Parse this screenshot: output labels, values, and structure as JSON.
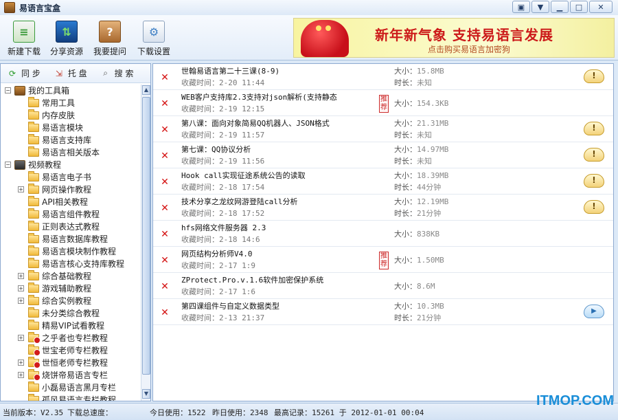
{
  "window": {
    "title": "易语言宝盒",
    "buttons": [
      "chat-icon",
      "dropdown-icon",
      "minimize-icon",
      "maximize-icon",
      "close-icon"
    ]
  },
  "toolbar": {
    "items": [
      {
        "label": "新建下载",
        "icon": "new-download-icon",
        "color": "#3a9a3a"
      },
      {
        "label": "分享资源",
        "icon": "share-icon",
        "color": "#1d5fa8"
      },
      {
        "label": "我要提问",
        "icon": "question-icon",
        "color": "#b5773a"
      },
      {
        "label": "下载设置",
        "icon": "settings-icon",
        "color": "#7a8fa8"
      }
    ]
  },
  "banner": {
    "headline": "新年新气象 支持易语言发展",
    "subline": "点击购买易语言加密狗"
  },
  "sidebar": {
    "tabs": [
      {
        "label": "同 步",
        "icon": "sync-icon"
      },
      {
        "label": "托 盘",
        "icon": "tray-icon"
      },
      {
        "label": "搜 索",
        "icon": "search-icon"
      }
    ],
    "tree": [
      {
        "label": "我的工具箱",
        "level": 0,
        "expander": "−",
        "type": "root"
      },
      {
        "label": "常用工具",
        "level": 1,
        "expander": "",
        "type": "folder"
      },
      {
        "label": "内存皮肤",
        "level": 1,
        "expander": "",
        "type": "folder"
      },
      {
        "label": "易语言模块",
        "level": 1,
        "expander": "",
        "type": "folder"
      },
      {
        "label": "易语言支持库",
        "level": 1,
        "expander": "",
        "type": "folder"
      },
      {
        "label": "易语言相关版本",
        "level": 1,
        "expander": "",
        "type": "folder"
      },
      {
        "label": "视频教程",
        "level": 0,
        "expander": "−",
        "type": "root"
      },
      {
        "label": "易语言电子书",
        "level": 1,
        "expander": "",
        "type": "folder"
      },
      {
        "label": "网页操作教程",
        "level": 1,
        "expander": "+",
        "type": "folder"
      },
      {
        "label": "API相关教程",
        "level": 1,
        "expander": "",
        "type": "folder"
      },
      {
        "label": "易语言组件教程",
        "level": 1,
        "expander": "",
        "type": "folder"
      },
      {
        "label": "正则表达式教程",
        "level": 1,
        "expander": "",
        "type": "folder"
      },
      {
        "label": "易语言数据库教程",
        "level": 1,
        "expander": "",
        "type": "folder"
      },
      {
        "label": "易语言模块制作教程",
        "level": 1,
        "expander": "",
        "type": "folder"
      },
      {
        "label": "易语言核心支持库教程",
        "level": 1,
        "expander": "",
        "type": "folder"
      },
      {
        "label": "综合基础教程",
        "level": 1,
        "expander": "+",
        "type": "folder"
      },
      {
        "label": "游戏辅助教程",
        "level": 1,
        "expander": "+",
        "type": "folder"
      },
      {
        "label": "综合实例教程",
        "level": 1,
        "expander": "+",
        "type": "folder"
      },
      {
        "label": "未分类综合教程",
        "level": 1,
        "expander": "",
        "type": "folder"
      },
      {
        "label": "精易VIP试看教程",
        "level": 1,
        "expander": "",
        "type": "folder"
      },
      {
        "label": "之乎者也专栏教程",
        "level": 1,
        "expander": "+",
        "type": "folder-red"
      },
      {
        "label": "世宝老师专栏教程",
        "level": 1,
        "expander": "",
        "type": "folder-red"
      },
      {
        "label": "世恒老师专栏教程",
        "level": 1,
        "expander": "+",
        "type": "folder-red"
      },
      {
        "label": "烧饼帝易语言专栏",
        "level": 1,
        "expander": "+",
        "type": "folder-red"
      },
      {
        "label": "小磊易语言黑月专栏",
        "level": 1,
        "expander": "",
        "type": "folder"
      },
      {
        "label": "孤风易语言专栏教程",
        "level": 1,
        "expander": "",
        "type": "folder"
      }
    ]
  },
  "downloads": {
    "time_prefix": "收藏时间：",
    "size_prefix": "大小：",
    "duration_prefix": "时长：",
    "recommend_label": "推荐",
    "rows": [
      {
        "title": "世翰易语言第二十三课(8-9)",
        "time": "2-20 11:44",
        "size": "15.8MB",
        "duration": "未知",
        "recommended": false,
        "action": "warn"
      },
      {
        "title": "WEB客户支持库2.3支持对json解析(支持静态",
        "time": "2-19 12:15",
        "size": "154.3KB",
        "duration": "",
        "recommended": true,
        "action": ""
      },
      {
        "title": "第八课：面向对象简易QQ机器人、JSON格式",
        "time": "2-19 11:57",
        "size": "21.31MB",
        "duration": "未知",
        "recommended": false,
        "action": "warn"
      },
      {
        "title": "第七课：QQ协议分析",
        "time": "2-19 11:56",
        "size": "14.97MB",
        "duration": "未知",
        "recommended": false,
        "action": "warn"
      },
      {
        "title": "Hook call实现征途系统公告的读取",
        "time": "2-18 17:54",
        "size": "18.39MB",
        "duration": "44分钟",
        "recommended": false,
        "action": "warn"
      },
      {
        "title": "技术分享之龙纹网游登陆call分析",
        "time": "2-18 17:52",
        "size": "12.19MB",
        "duration": "21分钟",
        "recommended": false,
        "action": "warn"
      },
      {
        "title": "hfs网络文件服务器 2.3",
        "time": "2-18 14:6",
        "size": "838KB",
        "duration": "",
        "recommended": false,
        "action": ""
      },
      {
        "title": "网页结构分析师V4.0",
        "time": "2-17 1:9",
        "size": "1.50MB",
        "duration": "",
        "recommended": true,
        "action": ""
      },
      {
        "title": "ZProtect.Pro.v.1.6软件加密保护系统",
        "time": "2-17 1:6",
        "size": "8.6M",
        "duration": "",
        "recommended": false,
        "action": ""
      },
      {
        "title": "第四课组件与自定义数据类型",
        "time": "2-13 21:37",
        "size": "10.3MB",
        "duration": "21分钟",
        "recommended": false,
        "action": "play"
      }
    ]
  },
  "status": {
    "version": "当前版本：V2.35",
    "speed": "下载总速度：",
    "today": "今日使用：1522",
    "yesterday": "昨日使用：2348",
    "record": "最高记录：15261 于 2012-01-01 00:04"
  },
  "watermark": "ITMOP.COM",
  "colors": {
    "accent": "#1a8ed8",
    "delete": "#d41212",
    "banner_text": "#cc1a1a"
  }
}
